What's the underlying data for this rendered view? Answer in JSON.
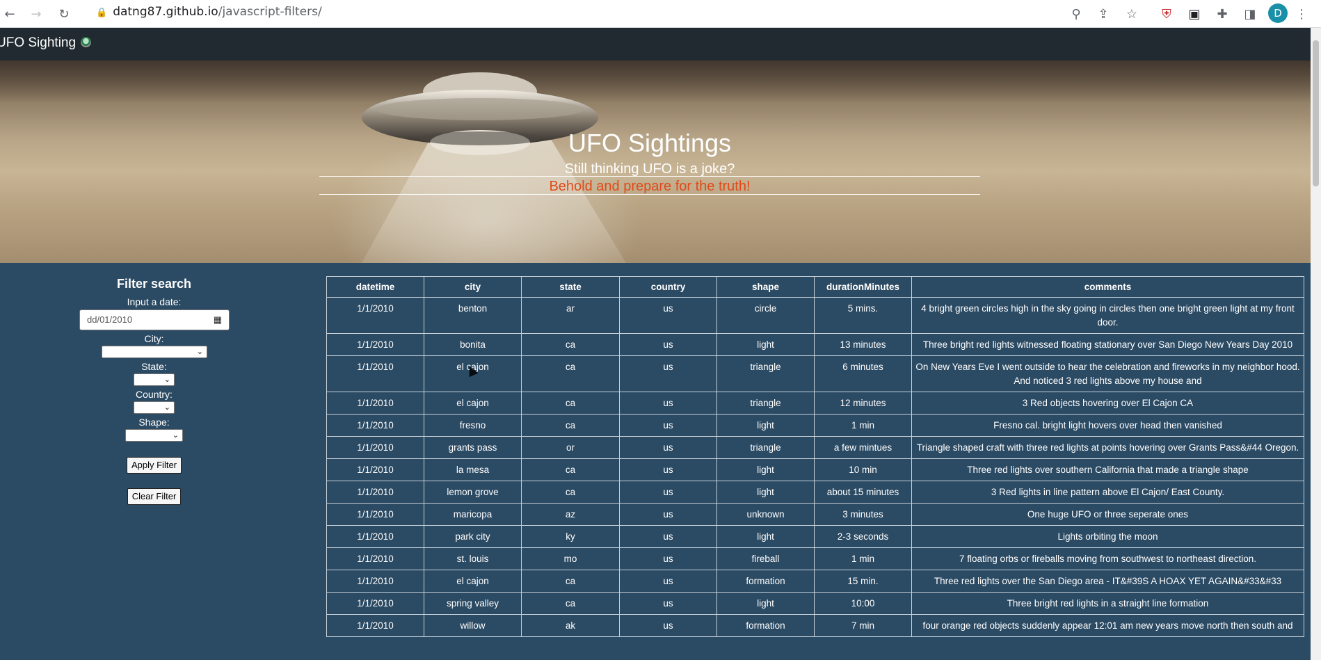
{
  "browser": {
    "url_host": "datng87.github.io",
    "url_path": "/javascript-filters/",
    "avatar_letter": "D"
  },
  "navbar": {
    "brand": "UFO Sighting"
  },
  "hero": {
    "title": "UFO Sightings",
    "subtitle": "Still thinking UFO is a joke?",
    "tagline": "Behold and prepare for the truth!"
  },
  "filter": {
    "heading": "Filter search",
    "date_label": "Input a date:",
    "date_value": "dd/01/2010",
    "city_label": "City:",
    "state_label": "State:",
    "country_label": "Country:",
    "shape_label": "Shape:",
    "apply_label": "Apply Filter",
    "clear_label": "Clear Filter"
  },
  "table": {
    "headers": [
      "datetime",
      "city",
      "state",
      "country",
      "shape",
      "durationMinutes",
      "comments"
    ],
    "rows": [
      [
        "1/1/2010",
        "benton",
        "ar",
        "us",
        "circle",
        "5 mins.",
        "4 bright green circles high in the sky going in circles then one bright green light at my front door."
      ],
      [
        "1/1/2010",
        "bonita",
        "ca",
        "us",
        "light",
        "13 minutes",
        "Three bright red lights witnessed floating stationary over San Diego New Years Day 2010"
      ],
      [
        "1/1/2010",
        "el cajon",
        "ca",
        "us",
        "triangle",
        "6 minutes",
        "On New Years Eve I went outside to hear the celebration and fireworks in my neighbor hood. And noticed 3 red lights above my house and"
      ],
      [
        "1/1/2010",
        "el cajon",
        "ca",
        "us",
        "triangle",
        "12 minutes",
        "3 Red objects hovering over El Cajon CA"
      ],
      [
        "1/1/2010",
        "fresno",
        "ca",
        "us",
        "light",
        "1 min",
        "Fresno cal. bright light hovers over head then vanished"
      ],
      [
        "1/1/2010",
        "grants pass",
        "or",
        "us",
        "triangle",
        "a few mintues",
        "Triangle shaped craft with three red lights at points hovering over Grants Pass&#44 Oregon."
      ],
      [
        "1/1/2010",
        "la mesa",
        "ca",
        "us",
        "light",
        "10 min",
        "Three red lights over southern California that made a triangle shape"
      ],
      [
        "1/1/2010",
        "lemon grove",
        "ca",
        "us",
        "light",
        "about 15 minutes",
        "3 Red lights in line pattern above El Cajon/ East County."
      ],
      [
        "1/1/2010",
        "maricopa",
        "az",
        "us",
        "unknown",
        "3 minutes",
        "One huge UFO or three seperate ones"
      ],
      [
        "1/1/2010",
        "park city",
        "ky",
        "us",
        "light",
        "2-3 seconds",
        "Lights orbiting the moon"
      ],
      [
        "1/1/2010",
        "st. louis",
        "mo",
        "us",
        "fireball",
        "1 min",
        "7 floating orbs or fireballs moving from southwest to northeast direction."
      ],
      [
        "1/1/2010",
        "el cajon",
        "ca",
        "us",
        "formation",
        "15 min.",
        "Three red lights over the San Diego area - IT&#39S A HOAX YET AGAIN&#33&#33"
      ],
      [
        "1/1/2010",
        "spring valley",
        "ca",
        "us",
        "light",
        "10:00",
        "Three bright red lights in a straight line formation"
      ],
      [
        "1/1/2010",
        "willow",
        "ak",
        "us",
        "formation",
        "7 min",
        "four orange red objects suddenly appear 12:01 am new years move north then south and"
      ]
    ]
  }
}
